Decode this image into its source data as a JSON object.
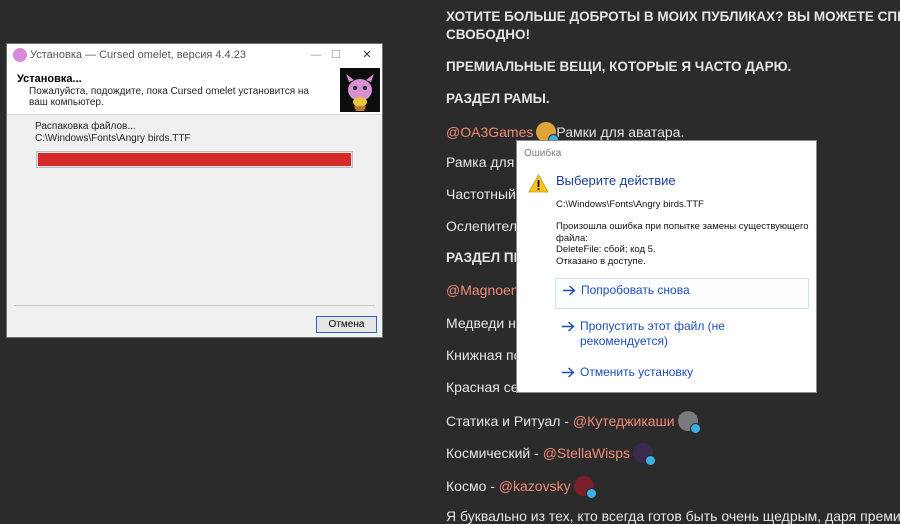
{
  "chat": {
    "line1a": "ХОТИТЕ БОЛЬШЕ ДОБРОТЫ В МОИХ ПУБЛИКАХ? ВЫ МОЖЕТЕ СПРОС",
    "line1b": "СВОБОДНО!",
    "line2": "ПРЕМИАЛЬНЫЕ ВЕЩИ, КОТОРЫЕ Я ЧАСТО ДАРЮ.",
    "line3": "РАЗДЕЛ РАМЫ.",
    "line4_mention": "@OA3Games",
    "line4_text": "Рамки для аватара.",
    "line5": "Рамка для а",
    "line6": "Частотный с",
    "line7": "Ослепитель",
    "line8": "РАЗДЕЛ ПР",
    "line9_mention": "@Magnoent",
    "line10": "Медведи на",
    "line11": "Книжная по",
    "line12": "Красная сет",
    "line13_text": "Статика и Ритуал - ",
    "line13_mention": "@Кутеджикаши",
    "line14_text": "Космический - ",
    "line14_mention": "@StellaWisps",
    "line15_text": "Космо - ",
    "line15_mention": "@kazovsky",
    "line16": "Я буквально из тех, кто всегда готов быть очень щедрым, даря премиум-фо"
  },
  "installer": {
    "title": "Установка — Cursed omelet, версия 4.4.23",
    "heading": "Установка...",
    "description": "Пожалуйста, подождите, пока Cursed omelet установится на ваш компьютер.",
    "status": "Распаковка файлов...",
    "current_file": "C:\\Windows\\Fonts\\Angry birds.TTF",
    "progress_percent": 100,
    "progress_color": "#d42a2a",
    "cancel_label": "Отмена",
    "minimize_glyph": "—",
    "maximize_glyph": "☐",
    "close_glyph": "✕"
  },
  "dialog": {
    "title": "Ошибка",
    "instruction": "Выберите действие",
    "file": "C:\\Windows\\Fonts\\Angry birds.TTF",
    "message_line1": "Произошла ошибка при попытке замены существующего",
    "message_line2": "файла:",
    "message_line3": "DeleteFile: сбой; код 5.",
    "message_line4": "Отказано в доступе.",
    "commands": [
      {
        "label": "Попробовать снова",
        "icon": "arrow-right-icon"
      },
      {
        "label": "Пропустить этот файл (не рекомендуется)",
        "icon": "arrow-right-icon"
      },
      {
        "label": "Отменить установку",
        "icon": "arrow-right-icon"
      }
    ],
    "accent_color": "#1c4db8",
    "warning_color": "#f7c51f"
  }
}
